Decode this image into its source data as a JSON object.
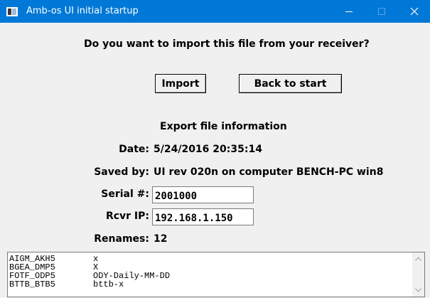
{
  "window": {
    "title": "Amb-os UI initial startup",
    "controls": [
      "minimize",
      "maximize",
      "close"
    ]
  },
  "prompt": "Do you want to import this file from your receiver?",
  "buttons": {
    "import_label": "Import",
    "back_label": "Back to start"
  },
  "export_info": {
    "heading": "Export file information",
    "date_label": "Date:",
    "date_value": "5/24/2016 20:35:14",
    "saved_by_label": "Saved by:",
    "saved_by_value": "UI rev 020n on computer BENCH-PC win8",
    "serial_label": "Serial #:",
    "serial_value": "2001000",
    "ip_label": "Rcvr IP:",
    "ip_value": "192.168.1.150",
    "renames_label": "Renames:",
    "renames_value": "12"
  },
  "renames_list": [
    {
      "code": "AIGM_AKH5",
      "name": "x"
    },
    {
      "code": "BGEA_DMP5",
      "name": "X"
    },
    {
      "code": "FOTF_ODP5",
      "name": "ODY-Daily-MM-DD"
    },
    {
      "code": "BTTB_BTB5",
      "name": "bttb-x"
    }
  ],
  "colors": {
    "titlebar": "#0078d7",
    "window_bg": "#f0f0f0"
  }
}
